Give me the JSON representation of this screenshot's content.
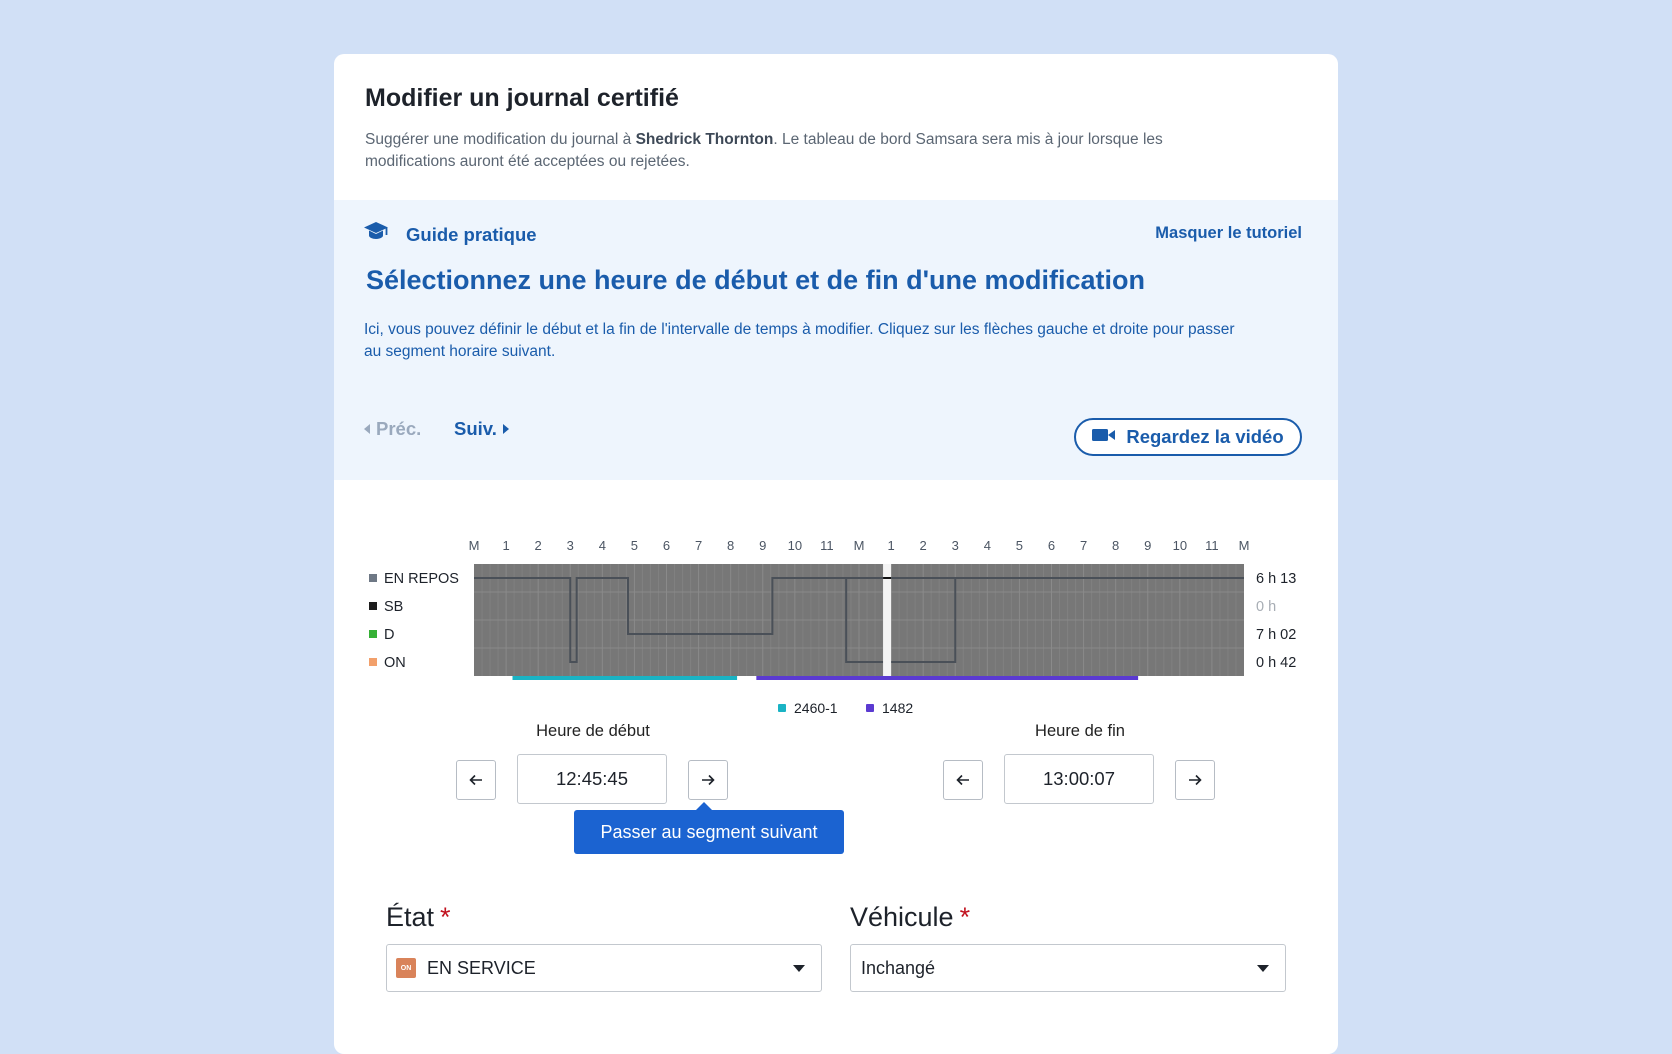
{
  "header": {
    "title": "Modifier un journal certifié",
    "desc_pre": "Suggérer une modification du journal à ",
    "driver": "Shedrick Thornton",
    "desc_post": ". Le tableau de bord Samsara sera mis à jour lorsque les modifications auront été acceptées ou rejetées."
  },
  "guide": {
    "label": "Guide pratique",
    "hide": "Masquer le tutoriel",
    "title": "Sélectionnez une heure de début et de fin d'une modification",
    "text": "Ici, vous pouvez définir le début et la fin de l'intervalle de temps à modifier. Cliquez sur les flèches gauche et droite pour passer au segment horaire suivant.",
    "prev": "Préc.",
    "next": "Suiv.",
    "video": "Regardez la vidéo"
  },
  "chart_data": {
    "type": "line",
    "hours": [
      "M",
      "1",
      "2",
      "3",
      "4",
      "5",
      "6",
      "7",
      "8",
      "9",
      "10",
      "11",
      "M",
      "1",
      "2",
      "3",
      "4",
      "5",
      "6",
      "7",
      "8",
      "9",
      "10",
      "11",
      "M"
    ],
    "rows": [
      {
        "label": "EN REPOS",
        "color": "#6e7885",
        "total": "6 h 13"
      },
      {
        "label": "SB",
        "color": "#1d1d1d",
        "total": "0 h"
      },
      {
        "label": "D",
        "color": "#35b035",
        "total": "7 h 02"
      },
      {
        "label": "ON",
        "color": "#f2a06b",
        "total": "0 h 42"
      }
    ],
    "status_line": [
      [
        0,
        0
      ],
      [
        3,
        0
      ],
      [
        3,
        3
      ],
      [
        3.2,
        3
      ],
      [
        3.2,
        0
      ],
      [
        4.8,
        0
      ],
      [
        4.8,
        2
      ],
      [
        9.3,
        2
      ],
      [
        9.3,
        0
      ],
      [
        15,
        0
      ],
      [
        15,
        3
      ],
      [
        11.6,
        3
      ],
      [
        11.6,
        0
      ],
      [
        24,
        0
      ]
    ],
    "selection": [
      12.75,
      13.0
    ],
    "vehicles": [
      {
        "name": "2460-1",
        "color": "#1ab3c4",
        "start": 1.2,
        "end": 8.2
      },
      {
        "name": "1482",
        "color": "#5b3ad1",
        "start": 8.8,
        "end": 20.7
      }
    ]
  },
  "start": {
    "label": "Heure de début",
    "value": "12:45:45"
  },
  "end": {
    "label": "Heure de fin",
    "value": "13:00:07"
  },
  "tooltip": "Passer au segment suivant",
  "form": {
    "state_label": "État",
    "state_value": "EN SERVICE",
    "state_badge": "ON",
    "vehicle_label": "Véhicule",
    "vehicle_value": "Inchangé",
    "required_mark": "*"
  }
}
